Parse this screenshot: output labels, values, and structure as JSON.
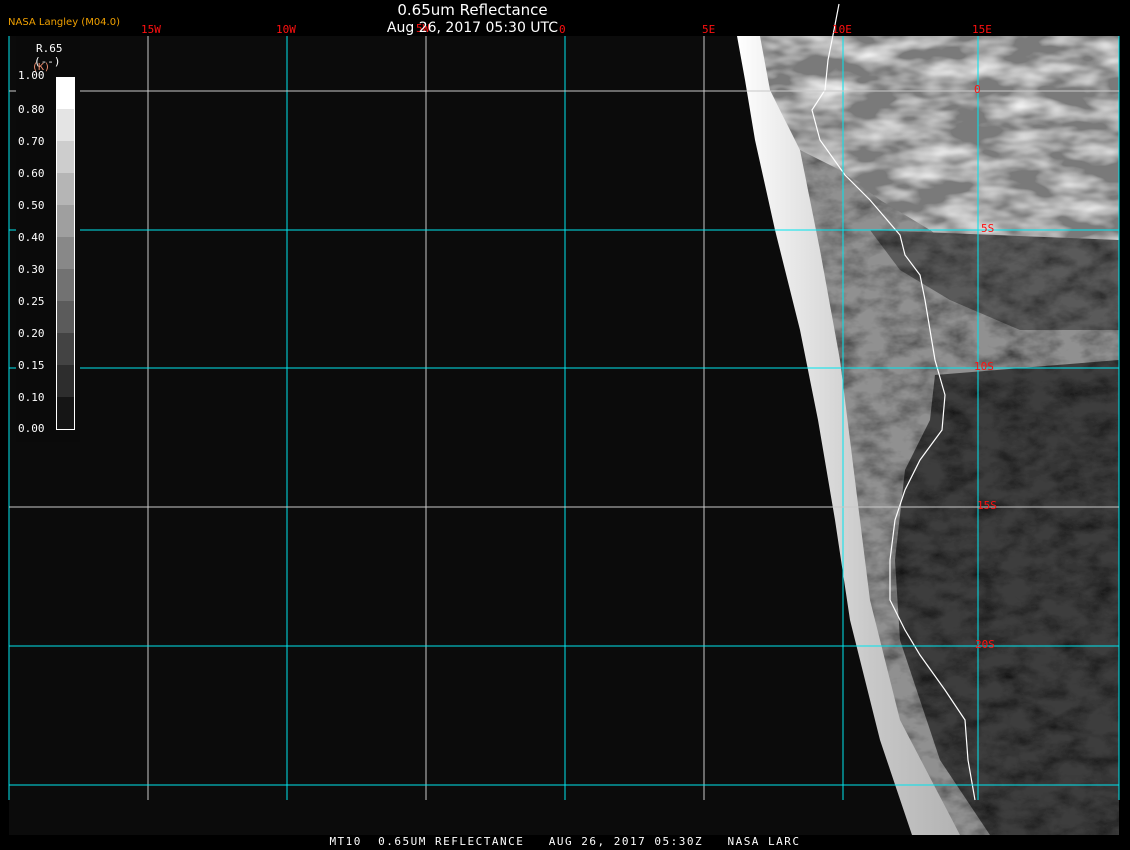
{
  "header": {
    "title": "0.65um Reflectance",
    "subtitle": "Aug 26, 2017 05:30 UTC",
    "brand": "NASA Langley (M04.0)"
  },
  "longitude_labels": [
    "15W",
    "10W",
    "5W",
    "0",
    "5E",
    "10E",
    "15E"
  ],
  "latitude_labels": [
    "0",
    "5S",
    "10S",
    "15S",
    "20S"
  ],
  "legend": {
    "variable": "R.65",
    "units": "(--)",
    "units_alt": "(K)",
    "labels": [
      "1.00",
      "0.80",
      "0.70",
      "0.60",
      "0.50",
      "0.40",
      "0.30",
      "0.25",
      "0.20",
      "0.15",
      "0.10",
      "0.00"
    ],
    "colors": [
      "#ffffff",
      "#e4e4e4",
      "#cdcdcd",
      "#b5b5b5",
      "#9f9f9f",
      "#888888",
      "#727272",
      "#5b5b5b",
      "#434343",
      "#2d2d2d",
      "#151515"
    ]
  },
  "colors": {
    "grid": "#00e5ee",
    "grid_alt": "#c8c8c8",
    "label": "#ff1010",
    "brand": "#f0a000"
  },
  "footer": "MT10  0.65UM REFLECTANCE   AUG 26, 2017 05:30Z   NASA LARC"
}
